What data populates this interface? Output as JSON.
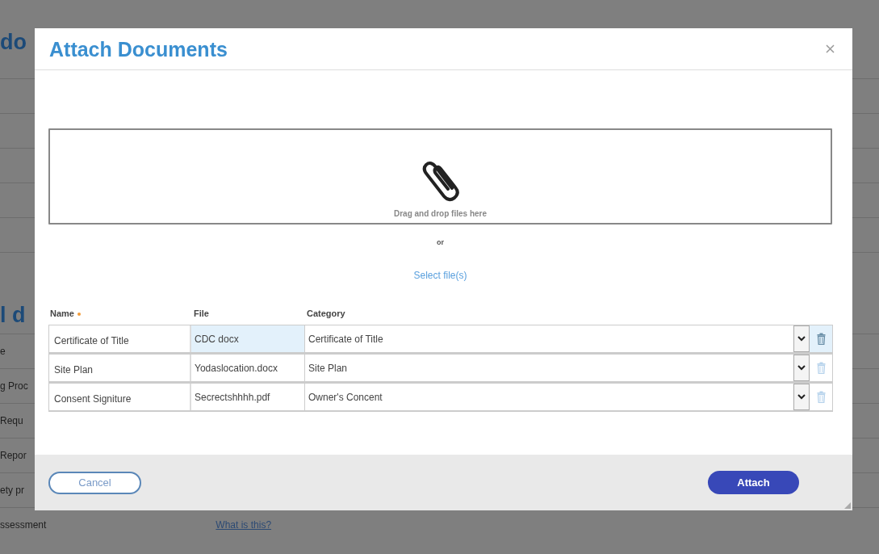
{
  "background": {
    "headings": [
      "do",
      "l d"
    ],
    "rows": [
      {
        "label": "e"
      },
      {
        "label": "g Proc"
      },
      {
        "label": "Requ"
      },
      {
        "label": "Repor"
      },
      {
        "label": "ety pr"
      },
      {
        "label": "ssessment",
        "link": "What is this?"
      }
    ]
  },
  "dialog": {
    "title": "Attach Documents",
    "dropzone": {
      "hint": "Drag and drop files here"
    },
    "or_text": "or",
    "select_link": "Select file(s)",
    "table": {
      "columns": [
        {
          "label": "Name",
          "required": true
        },
        {
          "label": "File",
          "required": false
        },
        {
          "label": "Category",
          "required": false
        }
      ],
      "rows": [
        {
          "name": "Certificate of Title",
          "file": "CDC docx",
          "category": "Certificate of Title",
          "selected": true
        },
        {
          "name": "Site Plan",
          "file": "Yodaslocation.docx",
          "category": "Site Plan",
          "selected": false
        },
        {
          "name": "Consent Signiture",
          "file": "Secrectshhhh.pdf",
          "category": "Owner's Concent",
          "selected": false
        }
      ]
    },
    "buttons": {
      "cancel": "Cancel",
      "attach": "Attach"
    }
  }
}
